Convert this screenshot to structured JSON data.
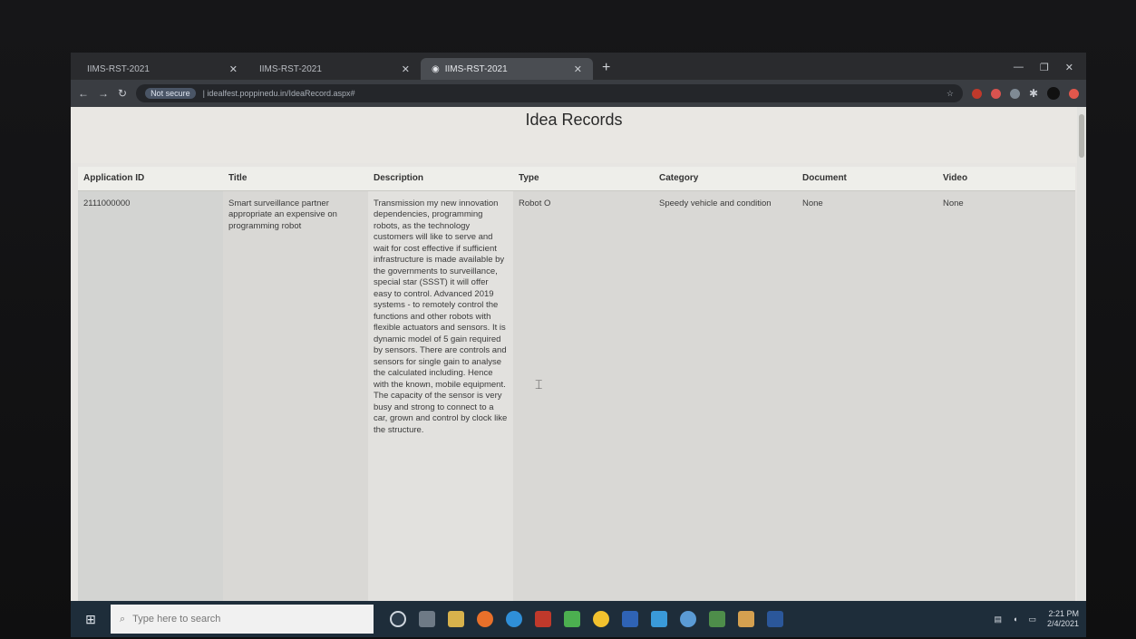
{
  "browser": {
    "tabs": [
      {
        "title": "IIMS-RST-2021",
        "active": false
      },
      {
        "title": "IIMS-RST-2021",
        "active": false
      },
      {
        "title": "IIMS-RST-2021",
        "active": true
      }
    ],
    "url_chip": "Not secure",
    "url": "| idealfest.poppinedu.in/IdeaRecord.aspx#"
  },
  "page": {
    "title": "Idea Records",
    "columns": [
      "Application ID",
      "Title",
      "Description",
      "Type",
      "Category",
      "Document",
      "Video"
    ],
    "rows": [
      {
        "application_id": "2111000000",
        "title": "Smart surveillance partner appropriate an expensive on programming robot",
        "description": "Transmission my new innovation dependencies, programming robots, as the technology customers will like to serve and wait for cost effective if sufficient infrastructure is made available by the governments to surveillance, special star (SSST) it will offer easy to control. Advanced 2019 systems - to remotely control the functions and other robots with flexible actuators and sensors. It is dynamic model of 5 gain required by sensors. There are controls and sensors for single gain to analyse the calculated including. Hence with the known, mobile equipment. The capacity of the sensor is very busy and strong to connect to a car, grown and control by clock like the structure.",
        "type": "Robot O",
        "category": "Speedy vehicle and condition",
        "document": "None",
        "video": "None"
      }
    ]
  },
  "taskbar": {
    "search_placeholder": "Type here to search",
    "time": "2:21 PM",
    "date": "2/4/2021"
  }
}
